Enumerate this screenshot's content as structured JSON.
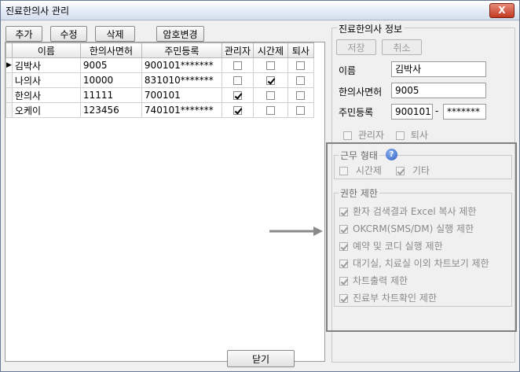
{
  "window": {
    "title": "진료한의사 관리",
    "close": "X"
  },
  "toolbar": {
    "add": "추가",
    "edit": "수정",
    "delete": "삭제",
    "password": "암호변경"
  },
  "grid": {
    "headers": [
      "이름",
      "한의사면허",
      "주민등록",
      "관리자",
      "시간제",
      "퇴사"
    ],
    "rows": [
      {
        "name": "김박사",
        "license": "9005",
        "resident": "900101*******",
        "admin": false,
        "parttime": false,
        "retired": false
      },
      {
        "name": "나의사",
        "license": "10000",
        "resident": "831010*******",
        "admin": false,
        "parttime": true,
        "retired": false
      },
      {
        "name": "한의사",
        "license": "11111",
        "resident": "700101",
        "admin": true,
        "parttime": false,
        "retired": false
      },
      {
        "name": "오케이",
        "license": "123456",
        "resident": "740101*******",
        "admin": true,
        "parttime": false,
        "retired": false
      }
    ]
  },
  "info": {
    "title": "진료한의사 정보",
    "save": "저장",
    "cancel": "취소",
    "name_label": "이름",
    "name_value": "김박사",
    "license_label": "한의사면허",
    "license_value": "9005",
    "resident_label": "주민등록",
    "resident_front": "900101",
    "resident_dash": "-",
    "resident_back": "*******",
    "admin_label": "관리자",
    "retired_label": "퇴사"
  },
  "work_type": {
    "legend": "근무 형태",
    "help_icon": "?",
    "parttime": "시간제",
    "other": "기타"
  },
  "permissions": {
    "legend": "권한 제한",
    "items": [
      "환자 검색결과 Excel 복사 제한",
      "OKCRM(SMS/DM) 실행 제한",
      "예약 및 코디 실행 제한",
      "대기실, 치료실 이외 차트보기 제한",
      "차트출력 제한",
      "진료부 차트확인 제한"
    ]
  },
  "footer": {
    "close": "닫기"
  },
  "colors": {
    "outline": "#808080",
    "close_button": "#c23a22",
    "help_icon": "#2a5bc4"
  }
}
